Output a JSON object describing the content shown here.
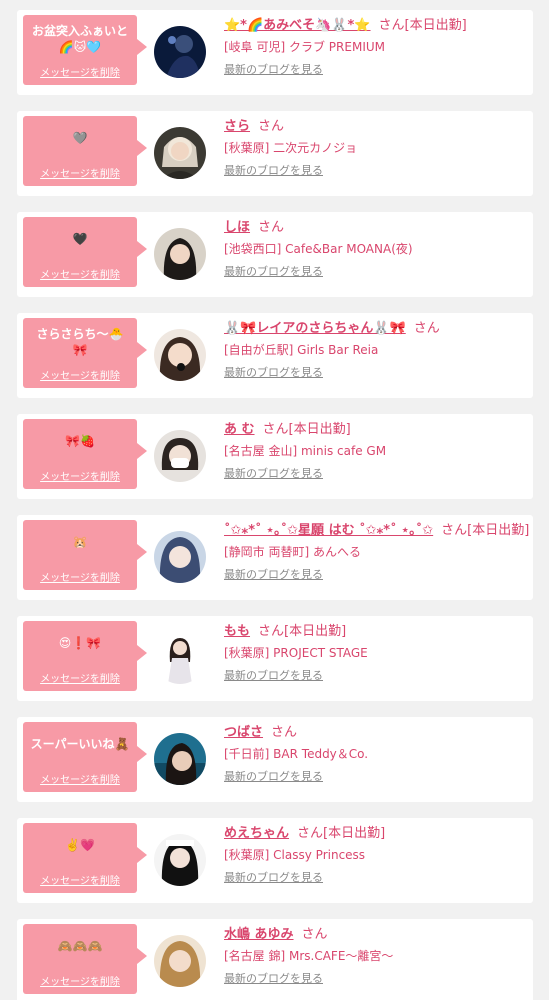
{
  "delete_label": "メッセージを削除",
  "blog_label": "最新のブログを見る",
  "san": "さん",
  "colors": {
    "background": "#f1f1f1",
    "bubble": "#f79aa6",
    "accent": "#d9466d",
    "link_gray": "#8a8a8a"
  },
  "entries": [
    {
      "message": "お盆突入ふぁいと\n🌈🐱🩵",
      "name": "⭐️*🌈あみべそ🦄🐰*⭐️",
      "status": "[本日出勤]",
      "shop": "[岐阜 可児] クラブ PREMIUM",
      "avatar_icon": "avatar-photo-1"
    },
    {
      "message": "🩶",
      "name": "さら",
      "status": "",
      "shop": "[秋葉原] 二次元カノジョ",
      "avatar_icon": "avatar-photo-2"
    },
    {
      "message": "🖤",
      "name": "しほ",
      "status": "",
      "shop": "[池袋西口] Cafe&Bar MOANA(夜)",
      "avatar_icon": "avatar-photo-3"
    },
    {
      "message": "さらさらち〜🐣\n🎀",
      "name": "🐰🎀レイアのさらちゃん🐰🎀",
      "status": "",
      "shop": "[自由が丘駅] Girls Bar Reia",
      "avatar_icon": "avatar-photo-4"
    },
    {
      "message": "🎀🍓",
      "name": "あ む",
      "status": "[本日出勤]",
      "shop": "[名古屋 金山] minis cafe GM",
      "avatar_icon": "avatar-photo-5"
    },
    {
      "message": "🐹",
      "name": "˚✩⁎*˚ ⋆｡˚✩星願 はむ ˚✩⁎*˚ ⋆｡˚✩",
      "status": "[本日出勤]",
      "shop": "[静岡市 両替町] あんへる",
      "avatar_icon": "avatar-photo-6"
    },
    {
      "message": "😍❗️🎀",
      "name": "もも",
      "status": "[本日出勤]",
      "shop": "[秋葉原] PROJECT STAGE",
      "avatar_icon": "avatar-photo-7"
    },
    {
      "message": "スーパーいいね🧸",
      "name": "つばさ",
      "status": "",
      "shop": "[千日前] BAR Teddy＆Co.",
      "avatar_icon": "avatar-photo-8"
    },
    {
      "message": "✌️💗",
      "name": "めえちゃん",
      "status": "[本日出勤]",
      "shop": "[秋葉原] Classy Princess",
      "avatar_icon": "avatar-photo-9"
    },
    {
      "message": "🙈🙈🙈",
      "name": "水嶋 あゆみ",
      "status": "",
      "shop": "[名古屋 錦] Mrs.CAFE〜離宮〜",
      "avatar_icon": "avatar-photo-10"
    }
  ]
}
